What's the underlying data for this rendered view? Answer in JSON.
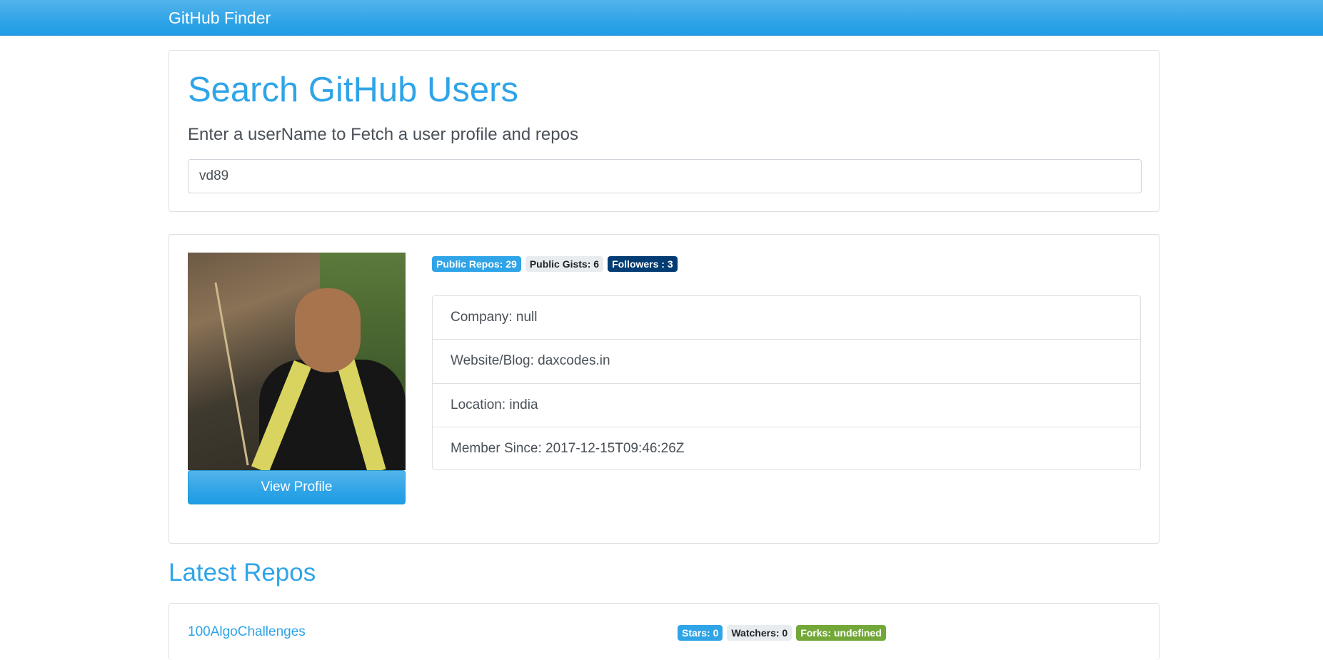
{
  "navbar": {
    "brand": "GitHub Finder"
  },
  "search": {
    "title": "Search GitHub Users",
    "lead": "Enter a userName to Fetch a user profile and repos",
    "value": "vd89"
  },
  "profile": {
    "view_profile_label": "View Profile",
    "badges": {
      "public_repos": "Public Repos: 29",
      "public_gists": "Public Gists: 6",
      "followers": "Followers : 3"
    },
    "details": {
      "company": "Company: null",
      "website": "Website/Blog: daxcodes.in",
      "location": "Location: india",
      "member_since": "Member Since: 2017-12-15T09:46:26Z"
    }
  },
  "repos": {
    "heading": "Latest Repos",
    "items": [
      {
        "name": "100AlgoChallenges",
        "stars": "Stars: 0",
        "watchers": "Watchers: 0",
        "forks": "Forks: undefined"
      }
    ]
  },
  "colors": {
    "primary": "#2fa4e7",
    "dark": "#033c73",
    "light": "#e9ecef",
    "success": "#73a839"
  }
}
